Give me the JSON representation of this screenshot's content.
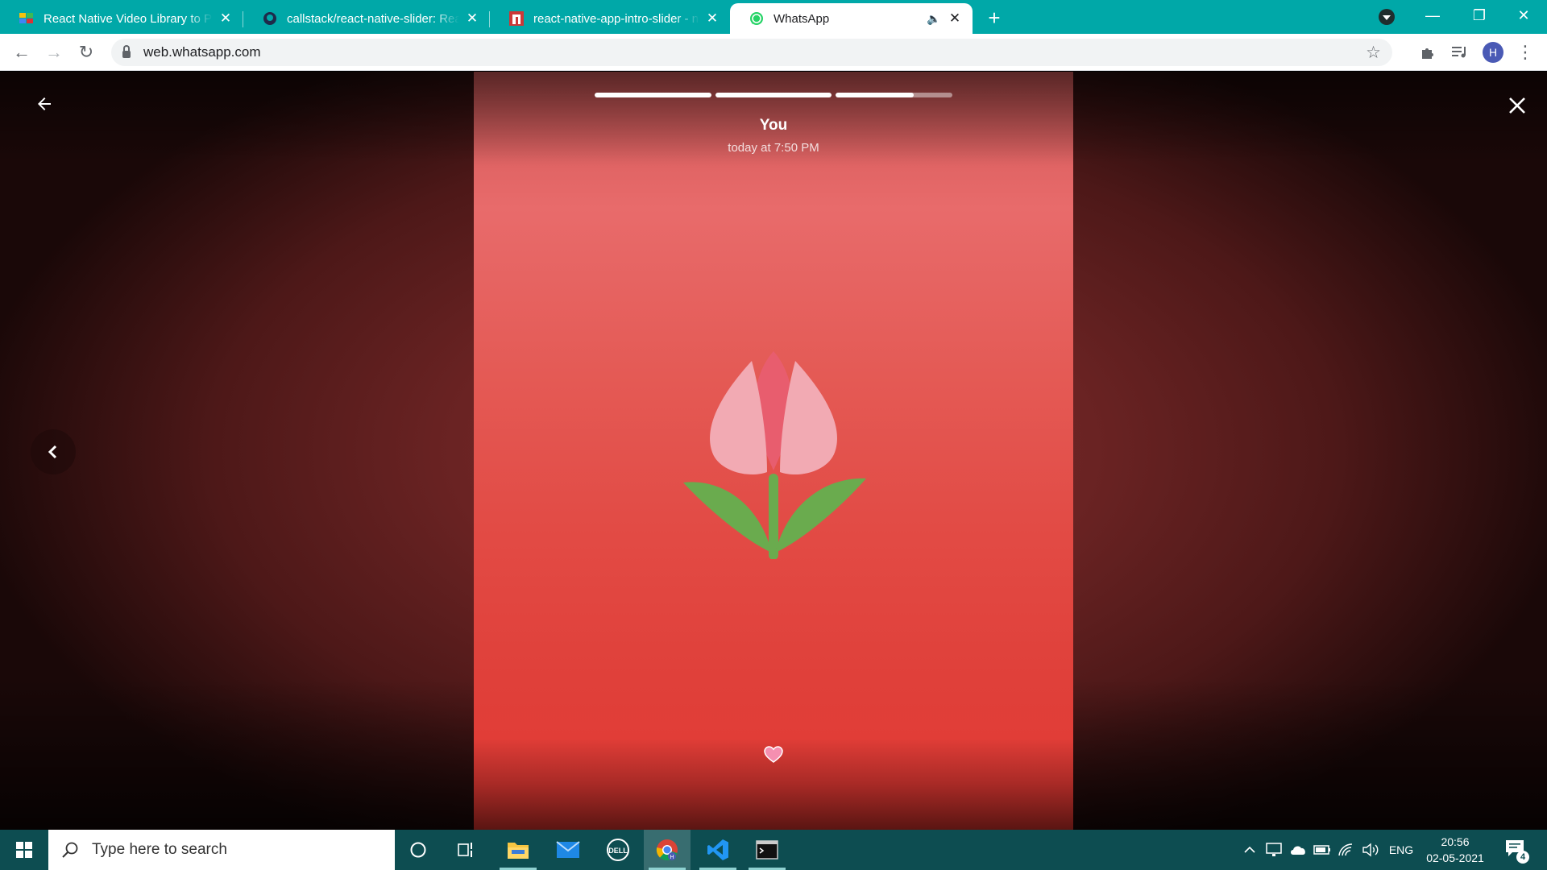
{
  "browser": {
    "tabs": [
      {
        "title": "React Native Video Library to Pla",
        "icon": "video-library-favicon"
      },
      {
        "title": "callstack/react-native-slider: Reac",
        "icon": "github-favicon"
      },
      {
        "title": "react-native-app-intro-slider - np",
        "icon": "npm-favicon"
      },
      {
        "title": "WhatsApp",
        "icon": "whatsapp-favicon",
        "active": true,
        "audio": true
      }
    ],
    "new_tab": "+",
    "url": "web.whatsapp.com",
    "profile_initial": "H",
    "colors": {
      "tabstrip": "#00a8a8",
      "accent": "#4a5ab5"
    }
  },
  "status_viewer": {
    "poster_name": "You",
    "post_time": "today at 7:50 PM",
    "progress": [
      1.0,
      1.0,
      0.67
    ],
    "reaction_icon": "heart-icon",
    "content_icon": "tulip",
    "colors": {
      "story_bg": "#e24b45",
      "backdrop": "#6a2323"
    }
  },
  "taskbar": {
    "search_placeholder": "Type here to search",
    "language": "ENG",
    "time": "20:56",
    "date": "02-05-2021",
    "notification_count": "4"
  }
}
